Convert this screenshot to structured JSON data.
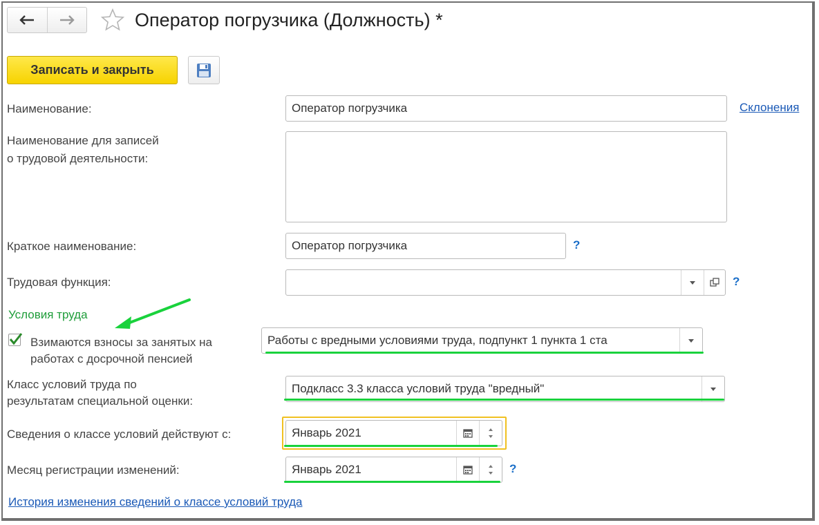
{
  "header": {
    "title": "Оператор погрузчика (Должность) *"
  },
  "toolbar": {
    "save_close_label": "Записать и закрыть"
  },
  "form": {
    "name_label": "Наименование:",
    "name_value": "Оператор погрузчика",
    "declensions_link": "Склонения",
    "labor_name_label_line1": "Наименование для записей",
    "labor_name_label_line2": "о трудовой деятельности:",
    "labor_name_value": "",
    "short_name_label": "Краткое наименование:",
    "short_name_value": "Оператор погрузчика",
    "help_mark": "?",
    "labor_function_label": "Трудовая функция:",
    "labor_function_value": ""
  },
  "conditions": {
    "section_title": "Условия труда",
    "checkbox_checked": true,
    "checkbox_label_line1": "Взимаются взносы за занятых на",
    "checkbox_label_line2": "работах с досрочной пенсией",
    "work_type_value": "Работы с вредными условиями труда, подпункт 1 пункта 1 ста",
    "class_label_line1": "Класс условий труда по",
    "class_label_line2": "результатам специальной оценки:",
    "class_value": "Подкласс 3.3 класса условий труда \"вредный\"",
    "valid_from_label": "Сведения о классе условий действуют с:",
    "valid_from_value": "Январь 2021",
    "reg_month_label": "Месяц регистрации изменений:",
    "reg_month_value": "Январь 2021",
    "history_link": "История изменения сведений о классе условий труда"
  },
  "colors": {
    "accent_yellow": "#f7d300",
    "link_blue": "#1a59b6",
    "section_green": "#1f9d3a",
    "annotation_green": "#19d23c",
    "focus_border": "#f0c020"
  },
  "icons": {
    "back": "arrow-left-icon",
    "forward": "arrow-right-icon",
    "favorite": "star-icon",
    "save": "floppy-disk-icon",
    "calendar": "calendar-icon",
    "open": "open-window-icon",
    "annotation": "green-arrow-icon"
  }
}
